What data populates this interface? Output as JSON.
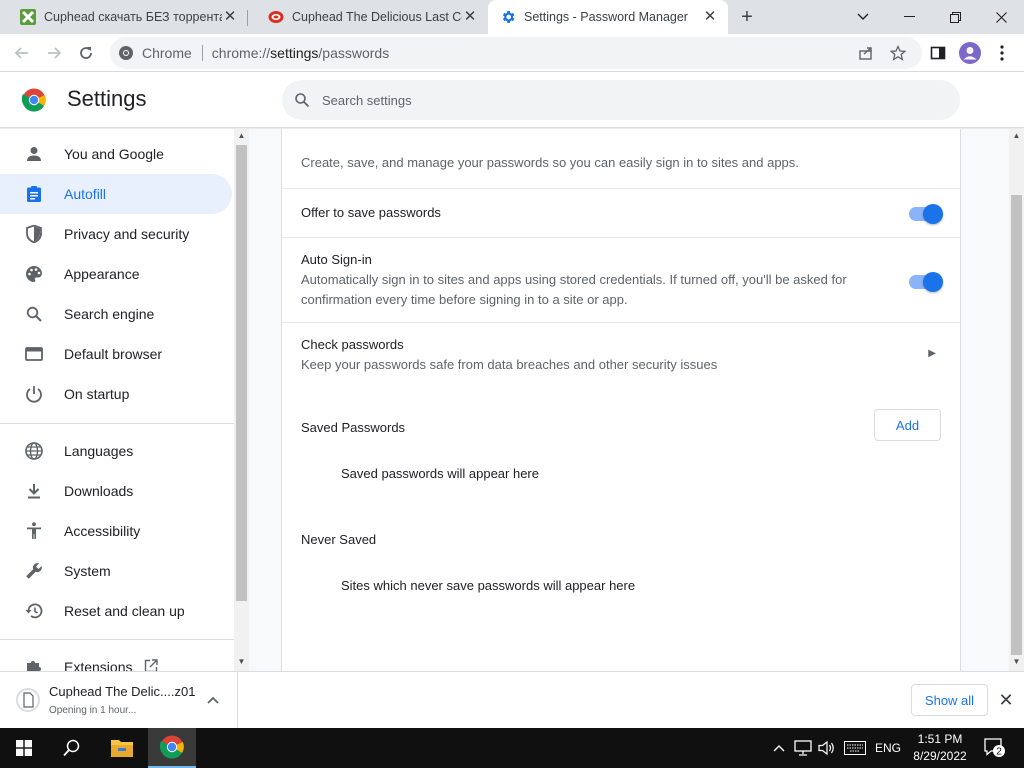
{
  "browser": {
    "tabs": [
      {
        "title": "Cuphead скачать БЕЗ торрента",
        "active": false,
        "favicon": "cuphead-x-icon"
      },
      {
        "title": "Cuphead The Delicious Last Cour",
        "active": false,
        "favicon": "game-site-icon"
      },
      {
        "title": "Settings - Password Manager",
        "active": true,
        "favicon": "settings-gear-icon"
      }
    ],
    "new_tab": "+",
    "site_label": "Chrome",
    "url_scheme": "chrome://",
    "url_host": "settings",
    "url_path": "/passwords"
  },
  "header": {
    "title": "Settings",
    "search_placeholder": "Search settings"
  },
  "sidebar": {
    "items": [
      {
        "label": "You and Google",
        "icon": "person-icon"
      },
      {
        "label": "Autofill",
        "icon": "clipboard-icon",
        "active": true
      },
      {
        "label": "Privacy and security",
        "icon": "shield-icon"
      },
      {
        "label": "Appearance",
        "icon": "palette-icon"
      },
      {
        "label": "Search engine",
        "icon": "search-icon"
      },
      {
        "label": "Default browser",
        "icon": "browser-window-icon"
      },
      {
        "label": "On startup",
        "icon": "power-icon"
      },
      {
        "label": "Languages",
        "icon": "globe-icon"
      },
      {
        "label": "Downloads",
        "icon": "download-icon"
      },
      {
        "label": "Accessibility",
        "icon": "accessibility-icon"
      },
      {
        "label": "System",
        "icon": "wrench-icon"
      },
      {
        "label": "Reset and clean up",
        "icon": "restore-icon"
      },
      {
        "label": "Extensions",
        "icon": "puzzle-icon"
      }
    ]
  },
  "passwords": {
    "intro": "Create, save, and manage your passwords so you can easily sign in to sites and apps.",
    "offer_to_save": {
      "label": "Offer to save passwords",
      "enabled": true
    },
    "auto_signin": {
      "label": "Auto Sign-in",
      "description_line1": "Automatically sign in to sites and apps using stored credentials. If turned off, you'll be asked for",
      "description_line2": "confirmation every time before signing in to a site or app.",
      "enabled": true
    },
    "check": {
      "label": "Check passwords",
      "description": "Keep your passwords safe from data breaches and other security issues"
    },
    "saved": {
      "heading": "Saved Passwords",
      "add_label": "Add",
      "empty": "Saved passwords will appear here"
    },
    "never_saved": {
      "heading": "Never Saved",
      "empty": "Sites which never save passwords will appear here"
    }
  },
  "download": {
    "filename": "Cuphead The Delic....z01",
    "status": "Opening in 1 hour...",
    "show_all": "Show all"
  },
  "taskbar": {
    "language": "ENG",
    "time": "1:51 PM",
    "date": "8/29/2022",
    "notifications": "2"
  },
  "colors": {
    "accent": "#1a73e8",
    "toggle_track": "#8ab4f8",
    "active_nav_bg": "#e8f0fe"
  }
}
